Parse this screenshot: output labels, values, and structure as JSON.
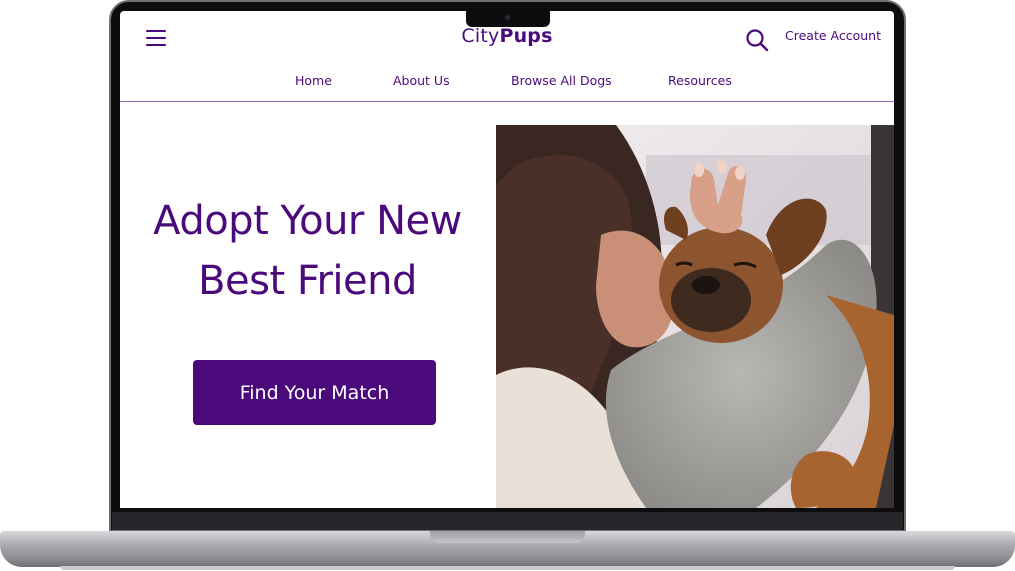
{
  "brand": {
    "prefix": "City",
    "suffix": "Pups"
  },
  "header": {
    "create_account_label": "Create Account"
  },
  "nav": {
    "items": [
      {
        "label": "Home"
      },
      {
        "label": "About Us"
      },
      {
        "label": "Browse All Dogs"
      },
      {
        "label": "Resources"
      }
    ]
  },
  "hero": {
    "title_line1": "Adopt Your New",
    "title_line2": "Best Friend",
    "cta_label": "Find Your Match"
  },
  "icons": {
    "menu": "hamburger-menu-icon",
    "search": "search-icon"
  },
  "colors": {
    "brand_purple": "#4b0a7c",
    "divider": "#9b63c3"
  }
}
